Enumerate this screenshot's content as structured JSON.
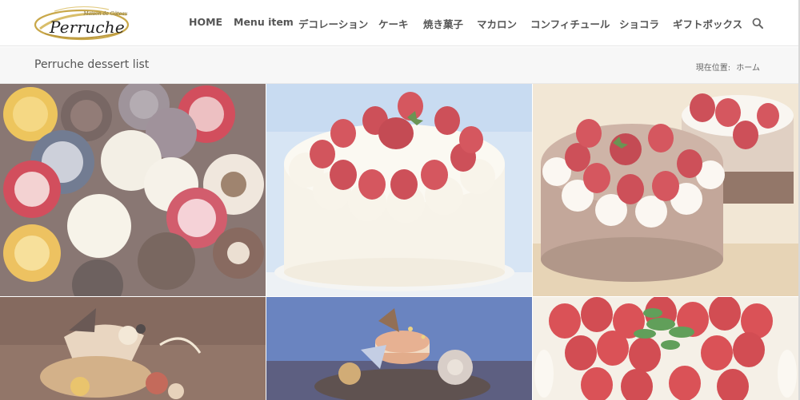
{
  "brand": {
    "tagline": "Maison de Gâteau",
    "name": "Perruche",
    "colors": {
      "gold": "#c9a84a",
      "text": "#555555"
    }
  },
  "nav": {
    "items": [
      {
        "label": "HOME"
      },
      {
        "label": "Menu item"
      },
      {
        "label": "デコレーション"
      },
      {
        "label": "ケーキ"
      },
      {
        "label": "焼き菓子"
      },
      {
        "label": "マカロン"
      },
      {
        "label": "コンフィチュール"
      },
      {
        "label": "ショコラ"
      },
      {
        "label": "ギフトボックス"
      }
    ],
    "search_icon": "search-icon"
  },
  "page": {
    "title": "Perruche dessert list",
    "breadcrumb_prefix": "現在位置:",
    "breadcrumb_home": "ホーム"
  },
  "gallery": {
    "tiles": [
      {
        "subject": "decorated-chocolate-discs"
      },
      {
        "subject": "strawberry-shortcake"
      },
      {
        "subject": "chocolate-strawberry-cake"
      },
      {
        "subject": "chocolate-decoration-cake"
      },
      {
        "subject": "macaron-tower-cake"
      },
      {
        "subject": "strawberry-tart"
      }
    ]
  }
}
